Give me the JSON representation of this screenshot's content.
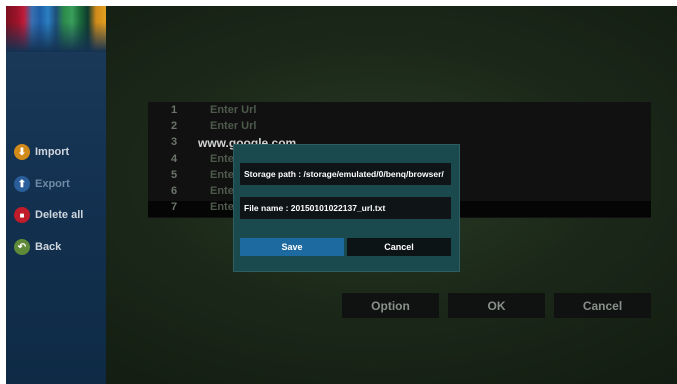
{
  "sidebar": {
    "items": [
      {
        "label": "Import",
        "icon": "download-icon",
        "color": "#d08a1a",
        "glyph": "⬇"
      },
      {
        "label": "Export",
        "icon": "upload-icon",
        "color": "#2a5e9a",
        "glyph": "⬆"
      },
      {
        "label": "Delete all",
        "icon": "trash-icon",
        "color": "#c01c2a",
        "glyph": "🗑"
      },
      {
        "label": "Back",
        "icon": "back-icon",
        "color": "#5f8a3a",
        "glyph": "↶"
      }
    ]
  },
  "url_list": {
    "rows": [
      {
        "num": "1",
        "text": "Enter Url"
      },
      {
        "num": "2",
        "text": "Enter Url"
      },
      {
        "num": "3",
        "text": "www.google.com"
      },
      {
        "num": "4",
        "text": "Ente"
      },
      {
        "num": "5",
        "text": "Ente"
      },
      {
        "num": "6",
        "text": "Ente"
      },
      {
        "num": "7",
        "text": "Ente"
      }
    ]
  },
  "dialog": {
    "storage_path": "Storage path : /storage/emulated/0/benq/browser/",
    "file_name": "File name : 20150101022137_url.txt",
    "save_label": "Save",
    "cancel_label": "Cancel"
  },
  "bottom_buttons": {
    "option_label": "Option",
    "ok_label": "OK",
    "cancel_label": "Cancel"
  }
}
